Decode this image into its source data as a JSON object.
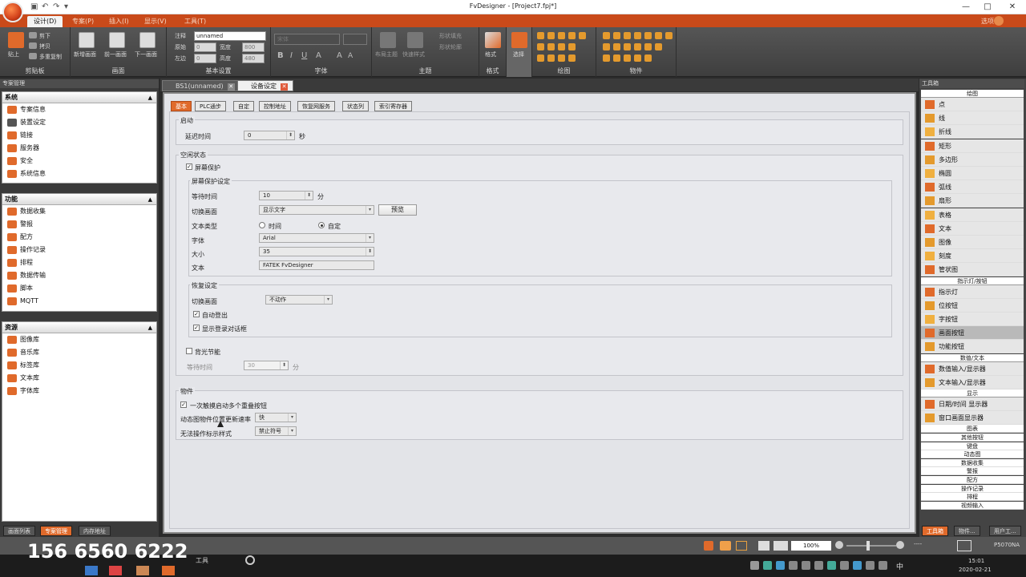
{
  "window": {
    "title": "FvDesigner - [Project7.fpj*]",
    "close_symbol": "✕",
    "minimize_symbol": "—",
    "maximize_symbol": "□"
  },
  "menu": {
    "tabs": [
      "设计(D)",
      "专案(P)",
      "插入(I)",
      "显示(V)",
      "工具(T)"
    ],
    "right_text": "选项"
  },
  "ribbon": {
    "clipboard": {
      "label": "剪贴板",
      "paste": "贴上",
      "cut": "剪下",
      "copy": "拷贝",
      "multi_copy": "多重复制"
    },
    "screen": {
      "label": "画面",
      "new_screen": "新增画面",
      "prev_screen": "前一画面",
      "next_screen": "下一画面"
    },
    "basic": {
      "label": "基本设置",
      "note_label": "注释",
      "note_value": "unnamed",
      "origin_label": "原始",
      "left_label": "左边",
      "width_label": "宽度",
      "height_label": "高度",
      "origin_value": "0",
      "left_value": "0",
      "width_value": "800",
      "height_value": "480"
    },
    "font": {
      "label": "字体",
      "font_name": "宋体",
      "bold": "B",
      "italic": "I",
      "underline": "U",
      "color_a": "A",
      "grow": "A",
      "shrink": "A"
    },
    "theme": {
      "label": "主题",
      "layout_theme": "布局主题",
      "quick_style": "快速样式",
      "shape_fill": "形状填充",
      "shape_outline": "形状轮廓"
    },
    "format": {
      "label": "格式",
      "format": "格式"
    },
    "select": {
      "label": "选择"
    },
    "draw": {
      "label": "绘图"
    },
    "objects": {
      "label": "物件"
    }
  },
  "left_panel": {
    "header": "专案管理",
    "sections": [
      {
        "title": "系统",
        "items": [
          "专案信息",
          "装置设定",
          "链接",
          "服务器",
          "安全",
          "系统信息"
        ]
      },
      {
        "title": "功能",
        "items": [
          "数据收集",
          "警报",
          "配方",
          "操作记录",
          "排程",
          "数据传输",
          "脚本",
          "MQTT"
        ]
      },
      {
        "title": "资源",
        "items": [
          "图像库",
          "音乐库",
          "标签库",
          "文本库",
          "字体库"
        ]
      }
    ],
    "bottom_tabs": [
      "画面列表",
      "专案管理",
      "内存地址"
    ]
  },
  "doc_tabs": [
    {
      "label": "BS1(unnamed)"
    },
    {
      "label": "设备设定"
    }
  ],
  "settings": {
    "tabs": [
      "基本",
      "PLC通步",
      "自定",
      "控制地址",
      "恢复网服务",
      "状态列",
      "索引寄存器"
    ],
    "startup": {
      "legend": "启动",
      "delay_label": "延迟时间",
      "delay_value": "0",
      "delay_unit": "秒"
    },
    "idle": {
      "legend": "空闲状态",
      "screensaver_label": "屏幕保护",
      "ss_settings": {
        "legend": "屏幕保护设定",
        "wait_label": "等待时间",
        "wait_value": "10",
        "wait_unit": "分",
        "switch_label": "切换画面",
        "switch_value": "显示文字",
        "preview_button": "预览",
        "text_type_label": "文本类型",
        "radio_time": "时间",
        "radio_custom": "自定",
        "font_label": "字体",
        "font_value": "Arial",
        "size_label": "大小",
        "size_value": "35",
        "text_label": "文本",
        "text_value": "FATEK   FvDesigner"
      },
      "restore": {
        "legend": "恢复设定",
        "switch_label": "切换画面",
        "switch_value": "不动作",
        "auto_logout": "自动登出",
        "show_login": "显示登录对话框"
      },
      "backlight": {
        "label": "背光节能",
        "wait_label": "等待时间",
        "wait_value": "30",
        "wait_unit": "分"
      }
    },
    "objects": {
      "legend": "物件",
      "multi_touch": "一次触摸启动多个重叠按钮",
      "update_rate_label": "动态图物件位置更新速率",
      "update_rate_value": "快",
      "inop_style_label": "无法操作标示样式",
      "inop_style_value": "禁止符号"
    }
  },
  "toolbox": {
    "header": "工具箱",
    "groups": [
      {
        "title": "绘图",
        "items": [
          "点",
          "线",
          "折线",
          "矩形",
          "多边形",
          "椭圆",
          "弧线",
          "扇形",
          "表格",
          "文本",
          "图像",
          "刻度",
          "管状图"
        ]
      },
      {
        "title": "指示灯/按钮",
        "items": [
          "指示灯",
          "位按钮",
          "字按钮",
          "画面按钮",
          "功能按钮"
        ]
      },
      {
        "title": "数值/文本",
        "items": [
          "数值输入/显示器",
          "文本输入/显示器"
        ]
      },
      {
        "title": "显示",
        "items": [
          "日期/时间 显示器",
          "窗口画面显示器"
        ]
      }
    ],
    "collapsed": [
      "图表",
      "其他按钮",
      "键盘",
      "动态图",
      "数据收集",
      "警报",
      "配方",
      "操作记录",
      "排程",
      "视频输入"
    ],
    "bottom_tabs": [
      "工具箱",
      "物件...",
      "用户工..."
    ]
  },
  "statusbar": {
    "zoom": "100%",
    "coords": "----",
    "model": "P5070NA"
  },
  "taskbar": {
    "time": "15:01",
    "date": "2020-02-21",
    "ime": "中",
    "tools_label": "工具"
  },
  "overlay": {
    "phone": "156 6560 6222"
  }
}
